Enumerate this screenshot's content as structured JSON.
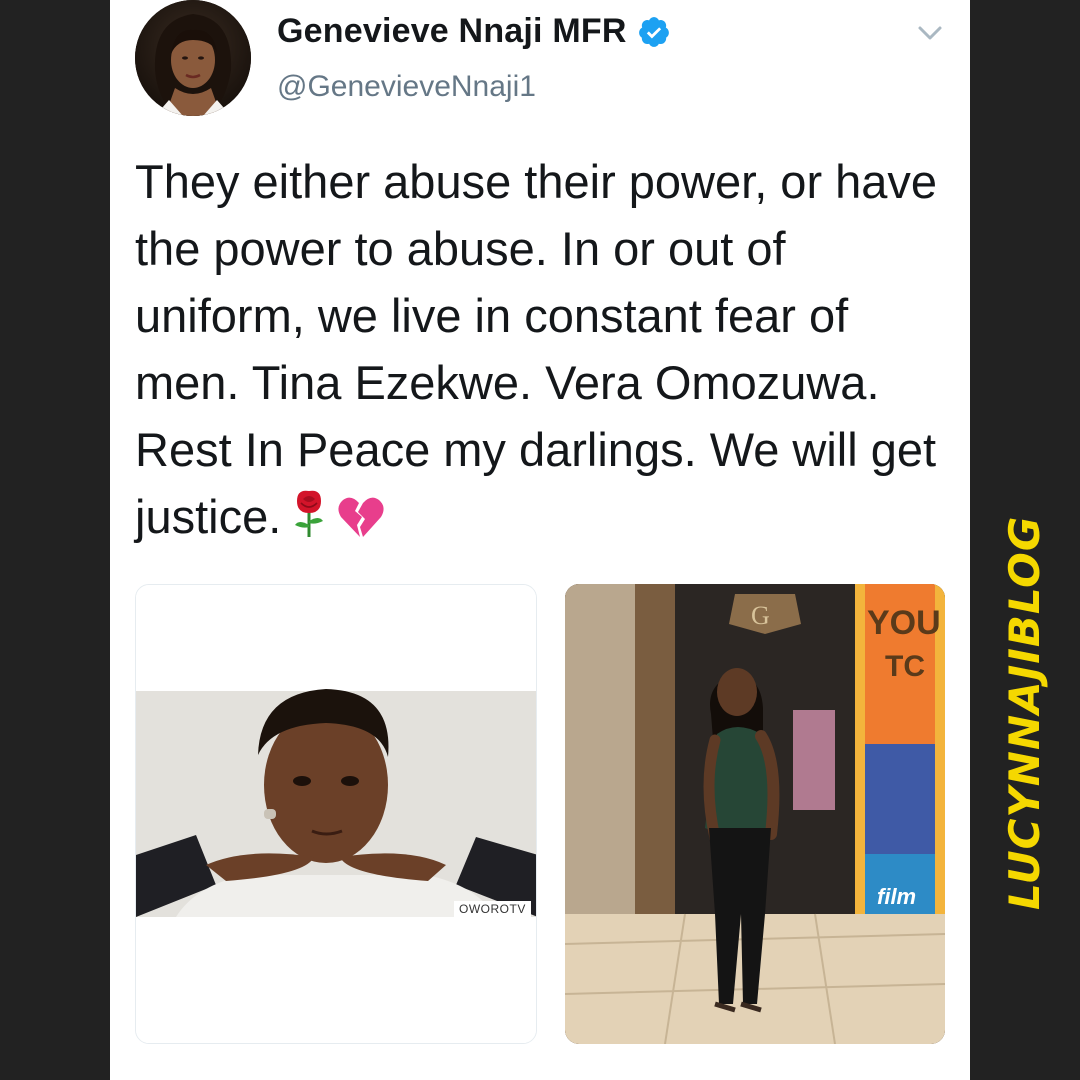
{
  "tweet": {
    "display_name": "Genevieve Nnaji MFR",
    "handle": "@GenevieveNnaji1",
    "verified": true,
    "text": "They either abuse their power, or have the power to abuse. In or out of uniform, we live in constant fear of men. Tina Ezekwe. Vera Omozuwa. Rest In Peace my darlings. We will get justice.",
    "emojis": [
      "rose-emoji",
      "broken-heart-emoji"
    ]
  },
  "media": {
    "left_image_tag": "OWOROTV",
    "right_image_poster_text_1": "YOU",
    "right_image_poster_text_2": "TC",
    "right_image_poster_text_3": "film"
  },
  "watermark": {
    "text": "LUCYNNAJIBLOG",
    "color": "#f5d800"
  },
  "colors": {
    "verified_blue": "#1da1f2",
    "text_primary": "#14171a",
    "text_secondary": "#657786",
    "frame_bg": "#222222"
  }
}
